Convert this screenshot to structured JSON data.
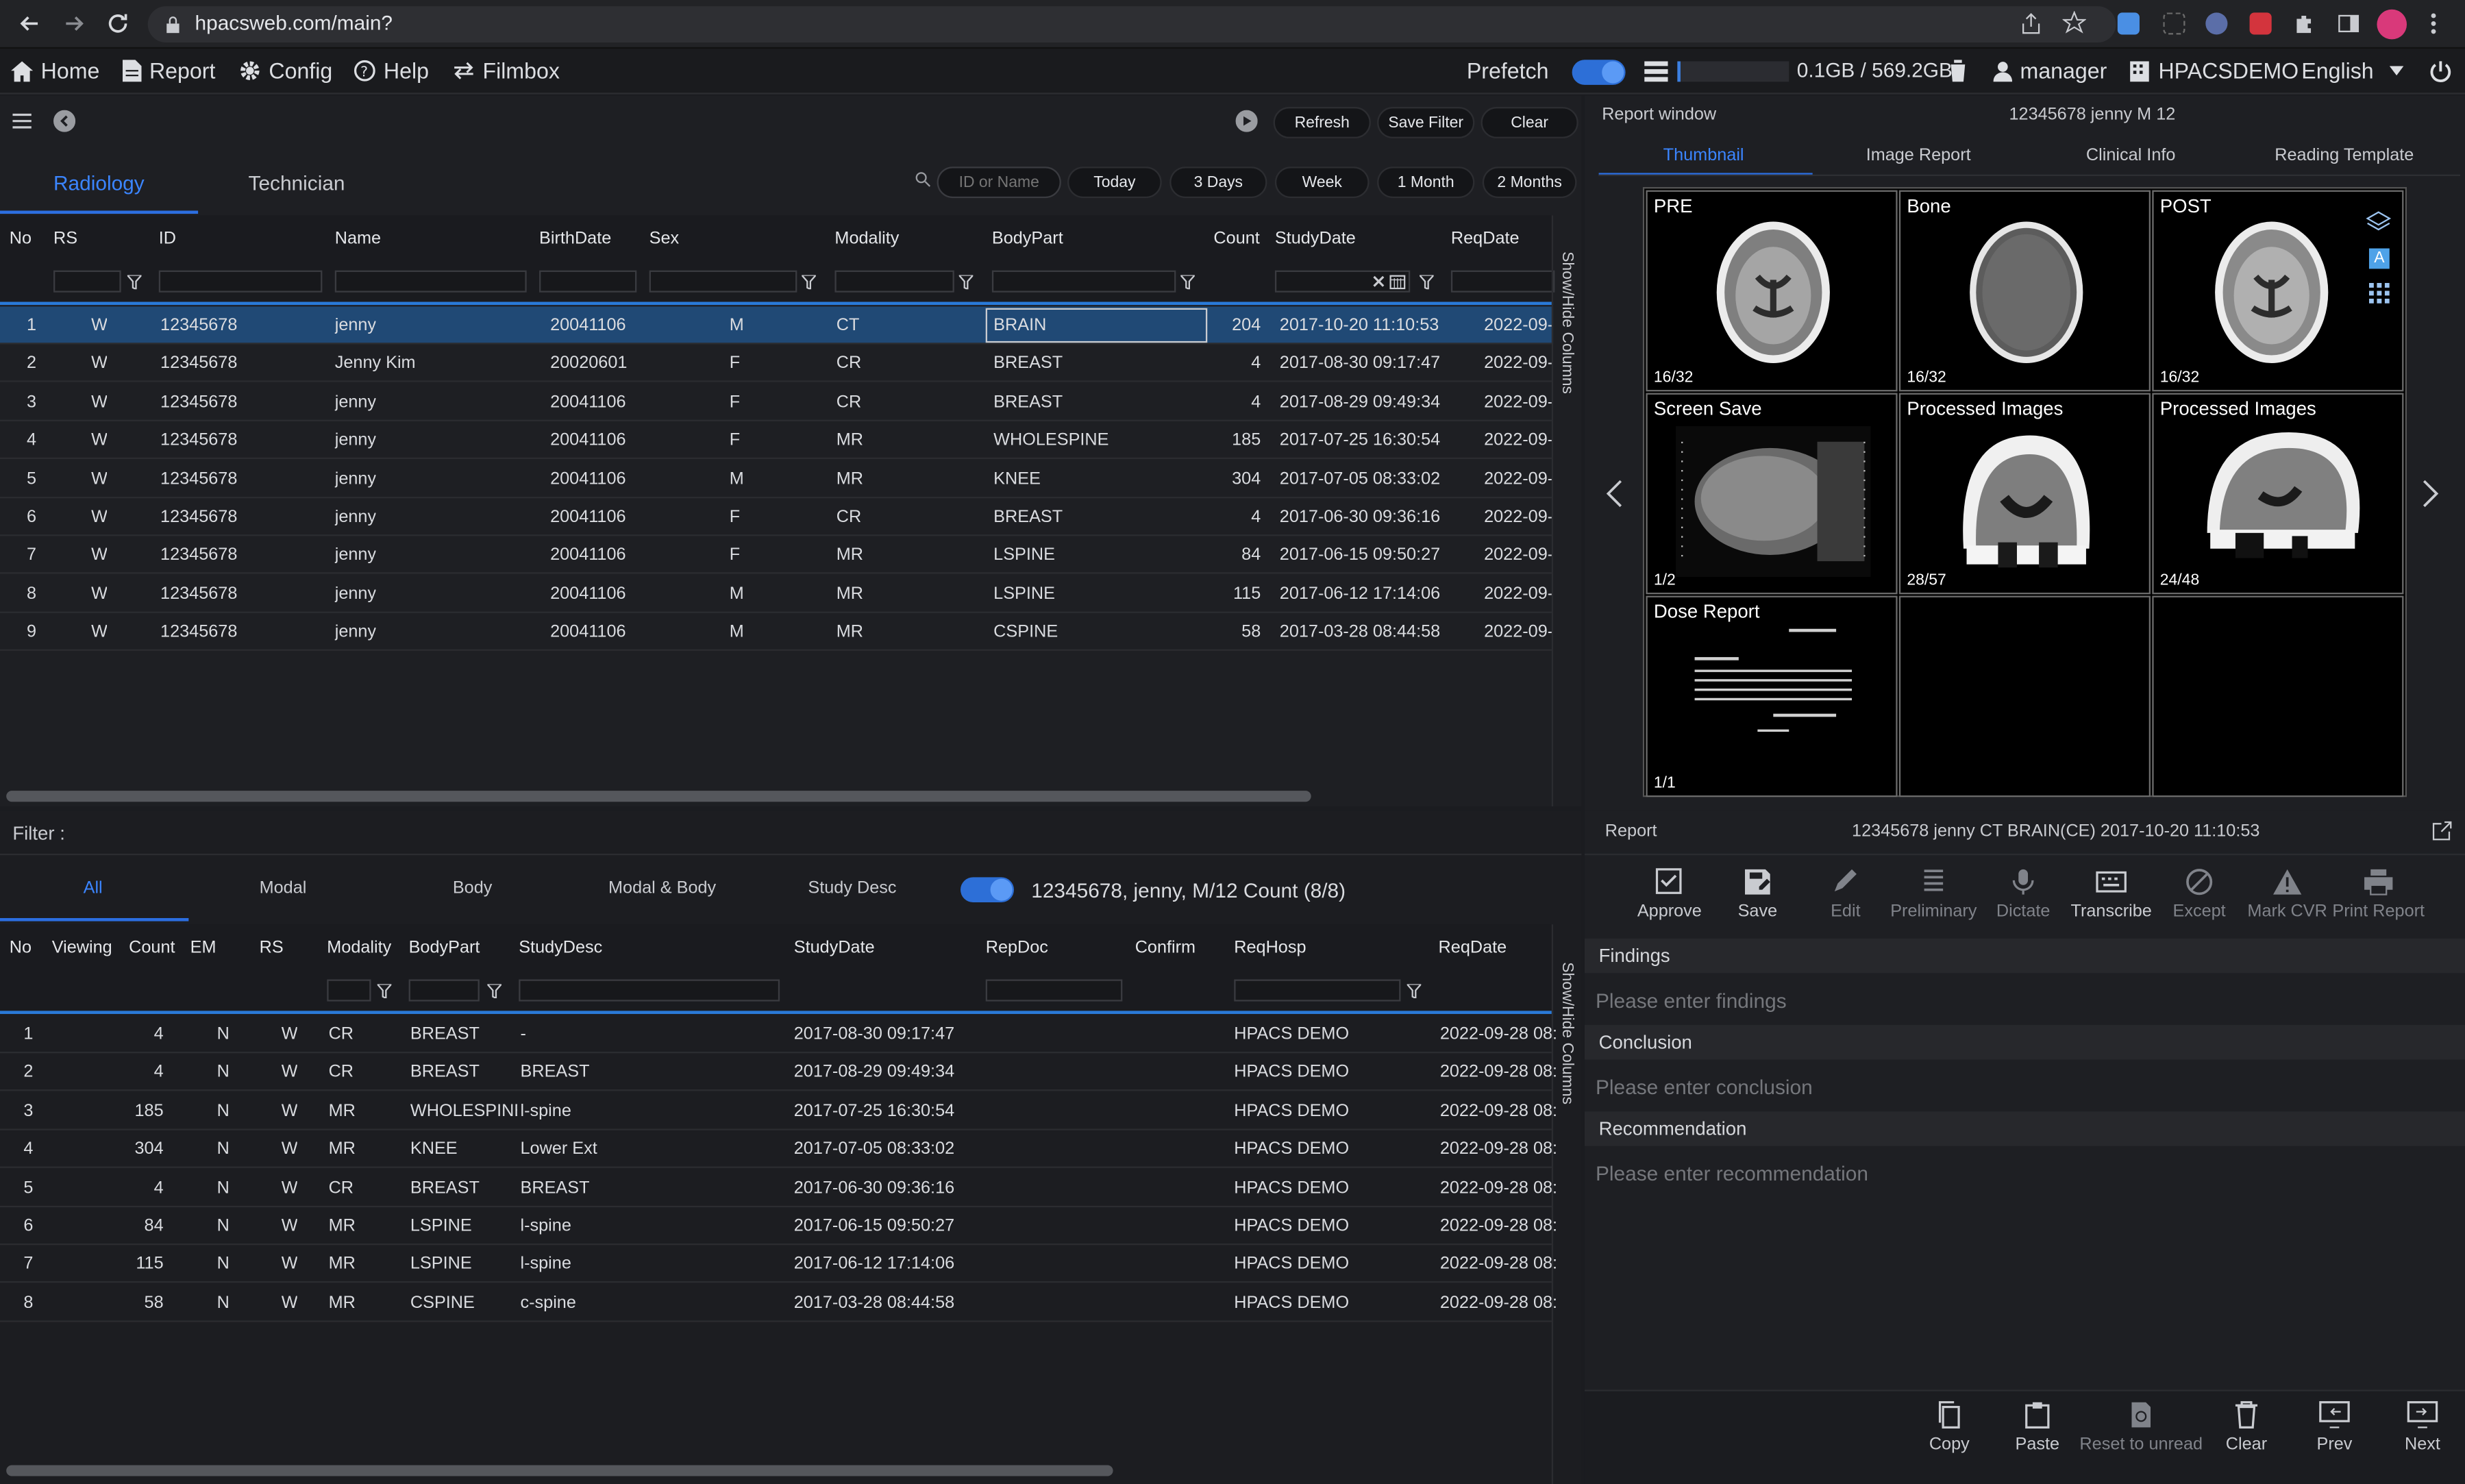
{
  "browser": {
    "url": "hpacsweb.com/main?"
  },
  "menu": {
    "home": "Home",
    "report": "Report",
    "config": "Config",
    "help": "Help",
    "filmbox": "Filmbox"
  },
  "status": {
    "prefetch": "Prefetch",
    "storage": "0.1GB / 569.2GB",
    "user": "manager",
    "site": "HPACSDEMO",
    "language": "English"
  },
  "worklist": {
    "buttons": {
      "refresh": "Refresh",
      "save_filter": "Save Filter",
      "clear": "Clear"
    },
    "tabs": [
      "Radiology",
      "Technician"
    ],
    "search_placeholder": "ID or Name",
    "ranges": [
      "Today",
      "3 Days",
      "Week",
      "1 Month",
      "2 Months"
    ],
    "columns": [
      "No",
      "RS",
      "ID",
      "Name",
      "BirthDate",
      "Sex",
      "Modality",
      "BodyPart",
      "Count",
      "StudyDate",
      "ReqDate"
    ],
    "rows": [
      [
        "1",
        "W",
        "12345678",
        "jenny",
        "20041106",
        "M",
        "CT",
        "BRAIN",
        "204",
        "2017-10-20 11:10:53",
        "2022-09-"
      ],
      [
        "2",
        "W",
        "12345678",
        "Jenny Kim",
        "20020601",
        "F",
        "CR",
        "BREAST",
        "4",
        "2017-08-30 09:17:47",
        "2022-09-"
      ],
      [
        "3",
        "W",
        "12345678",
        "jenny",
        "20041106",
        "F",
        "CR",
        "BREAST",
        "4",
        "2017-08-29 09:49:34",
        "2022-09-"
      ],
      [
        "4",
        "W",
        "12345678",
        "jenny",
        "20041106",
        "F",
        "MR",
        "WHOLESPINE",
        "185",
        "2017-07-25 16:30:54",
        "2022-09-"
      ],
      [
        "5",
        "W",
        "12345678",
        "jenny",
        "20041106",
        "M",
        "MR",
        "KNEE",
        "304",
        "2017-07-05 08:33:02",
        "2022-09-"
      ],
      [
        "6",
        "W",
        "12345678",
        "jenny",
        "20041106",
        "F",
        "CR",
        "BREAST",
        "4",
        "2017-06-30 09:36:16",
        "2022-09-"
      ],
      [
        "7",
        "W",
        "12345678",
        "jenny",
        "20041106",
        "F",
        "MR",
        "LSPINE",
        "84",
        "2017-06-15 09:50:27",
        "2022-09-"
      ],
      [
        "8",
        "W",
        "12345678",
        "jenny",
        "20041106",
        "M",
        "MR",
        "LSPINE",
        "115",
        "2017-06-12 17:14:06",
        "2022-09-"
      ],
      [
        "9",
        "W",
        "12345678",
        "jenny",
        "20041106",
        "M",
        "MR",
        "CSPINE",
        "58",
        "2017-03-28 08:44:58",
        "2022-09-"
      ]
    ],
    "show_hide": "Show/Hide Columns"
  },
  "history": {
    "filter_label": "Filter :",
    "tabs": [
      "All",
      "Modal",
      "Body",
      "Modal & Body",
      "Study Desc"
    ],
    "summary": "12345678, jenny, M/12 Count (8/8)",
    "columns": [
      "No",
      "Viewing",
      "Count",
      "EM",
      "RS",
      "Modality",
      "BodyPart",
      "StudyDesc",
      "StudyDate",
      "RepDoc",
      "Confirm",
      "ReqHosp",
      "ReqDate"
    ],
    "rows": [
      [
        "1",
        "4",
        "N",
        "W",
        "CR",
        "BREAST",
        "-",
        "2017-08-30 09:17:47",
        "HPACS DEMO",
        "2022-09-28 08:"
      ],
      [
        "2",
        "4",
        "N",
        "W",
        "CR",
        "BREAST",
        "BREAST",
        "2017-08-29 09:49:34",
        "HPACS DEMO",
        "2022-09-28 08:"
      ],
      [
        "3",
        "185",
        "N",
        "W",
        "MR",
        "WHOLESPINE",
        "l-spine",
        "2017-07-25 16:30:54",
        "HPACS DEMO",
        "2022-09-28 08:"
      ],
      [
        "4",
        "304",
        "N",
        "W",
        "MR",
        "KNEE",
        "Lower Ext",
        "2017-07-05 08:33:02",
        "HPACS DEMO",
        "2022-09-28 08:"
      ],
      [
        "5",
        "4",
        "N",
        "W",
        "CR",
        "BREAST",
        "BREAST",
        "2017-06-30 09:36:16",
        "HPACS DEMO",
        "2022-09-28 08:"
      ],
      [
        "6",
        "84",
        "N",
        "W",
        "MR",
        "LSPINE",
        "l-spine",
        "2017-06-15 09:50:27",
        "HPACS DEMO",
        "2022-09-28 08:"
      ],
      [
        "7",
        "115",
        "N",
        "W",
        "MR",
        "LSPINE",
        "l-spine",
        "2017-06-12 17:14:06",
        "HPACS DEMO",
        "2022-09-28 08:"
      ],
      [
        "8",
        "58",
        "N",
        "W",
        "MR",
        "CSPINE",
        "c-spine",
        "2017-03-28 08:44:58",
        "HPACS DEMO",
        "2022-09-28 08:"
      ]
    ],
    "show_hide": "Show/Hide Columns"
  },
  "report_window": {
    "title": "Report window",
    "patient": "12345678 jenny M 12",
    "tabs": [
      "Thumbnail",
      "Image Report",
      "Clinical Info",
      "Reading Template"
    ],
    "thumbnails": [
      {
        "label": "PRE",
        "count": "16/32"
      },
      {
        "label": "Bone",
        "count": "16/32"
      },
      {
        "label": "POST",
        "count": "16/32"
      },
      {
        "label": "Screen Save",
        "count": "1/2"
      },
      {
        "label": "Processed Images",
        "count": "28/57"
      },
      {
        "label": "Processed Images",
        "count": "24/48"
      },
      {
        "label": "Dose Report",
        "count": "1/1"
      }
    ]
  },
  "report": {
    "title": "Report",
    "study": "12345678 jenny CT BRAIN(CE) 2017-10-20 11:10:53",
    "tools": [
      "Approve",
      "Save",
      "Edit",
      "Preliminary",
      "Dictate",
      "Transcribe",
      "Except",
      "Mark CVR",
      "Print Report"
    ],
    "findings": "Findings",
    "findings_ph": "Please enter findings",
    "conclusion": "Conclusion",
    "conclusion_ph": "Please enter conclusion",
    "recommendation": "Recommendation",
    "recommendation_ph": "Please enter recommendation",
    "bottom": [
      "Copy",
      "Paste",
      "Reset to unread",
      "Clear",
      "Prev",
      "Next"
    ]
  }
}
